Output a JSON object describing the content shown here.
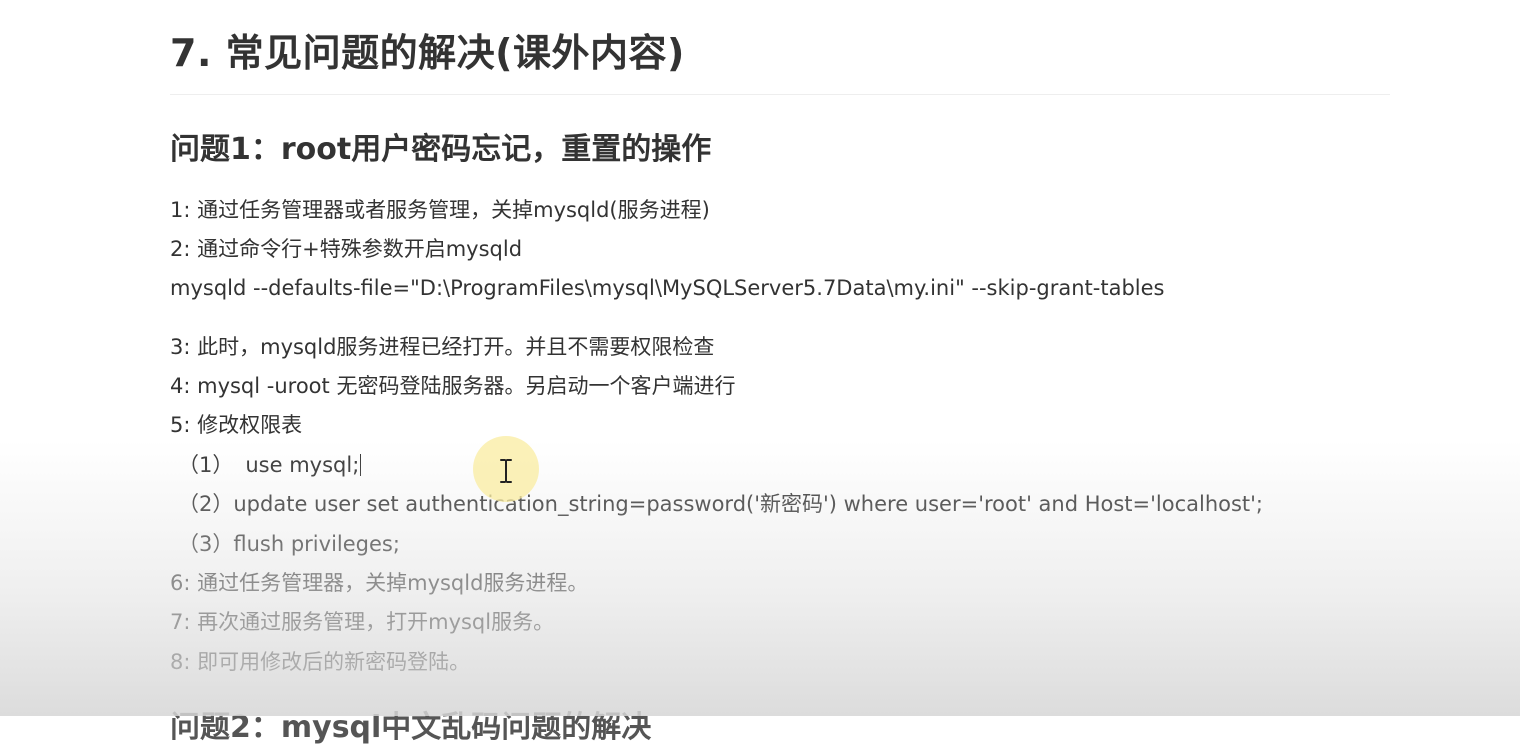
{
  "doc": {
    "h1": "7. 常见问题的解决(课外内容)",
    "h2": "问题1：root用户密码忘记，重置的操作",
    "steps": {
      "s1": "1: 通过任务管理器或者服务管理，关掉mysqld(服务进程)",
      "s2": "2: 通过命令行+特殊参数开启mysqld",
      "cmd": "mysqld --defaults-file=\"D:\\ProgramFiles\\mysql\\MySQLServer5.7Data\\my.ini\" --skip-grant-tables",
      "s3": "3: 此时，mysqld服务进程已经打开。并且不需要权限检查",
      "s4": "4: mysql -uroot 无密码登陆服务器。另启动一个客户端进行",
      "s5": "5: 修改权限表",
      "sub1_num": "（1）",
      "sub1_text": "use mysql;",
      "sub2_num": "（2）",
      "sub2_text": "update user set authentication_string=password('新密码') where user='root' and Host='localhost';",
      "sub3_num": "（3）",
      "sub3_text": "flush privileges;",
      "s6": "6: 通过任务管理器，关掉mysqld服务进程。",
      "s7": "7: 再次通过服务管理，打开mysql服务。",
      "s8": "8: 即可用修改后的新密码登陆。"
    },
    "next_heading_partial": "问题2：mysql中文乱码问题的解决"
  },
  "icons": {
    "cursor": "text-cursor-icon"
  },
  "colors": {
    "text": "#333333",
    "cursor_highlight": "#faeca0"
  }
}
